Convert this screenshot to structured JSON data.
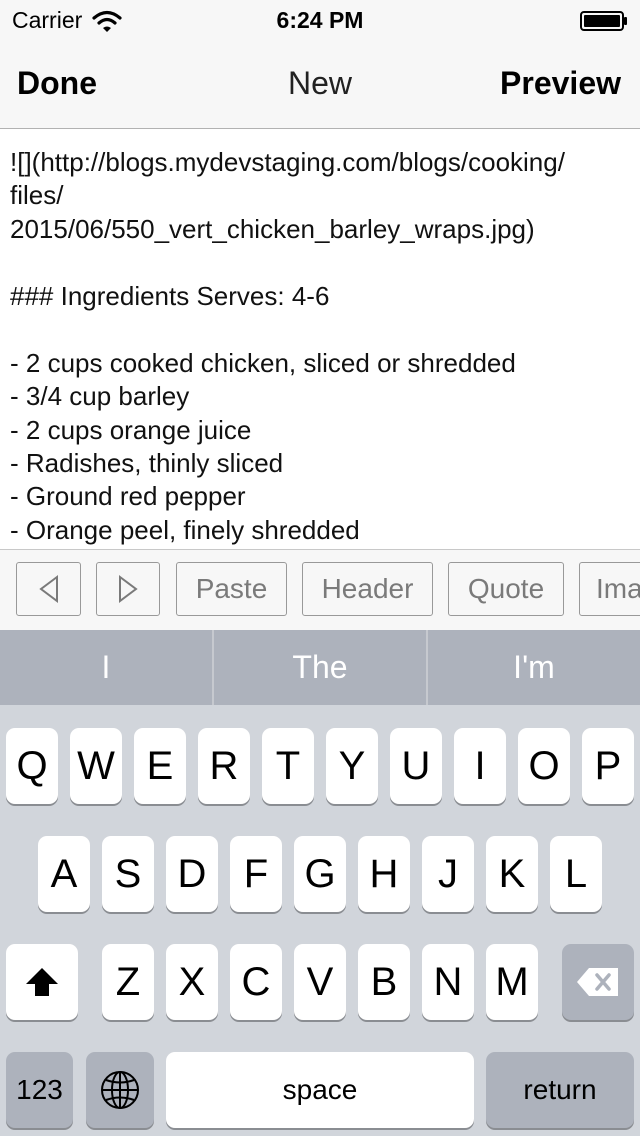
{
  "status_bar": {
    "carrier": "Carrier",
    "time": "6:24 PM"
  },
  "nav": {
    "left_label": "Done",
    "title": "New",
    "right_label": "Preview"
  },
  "editor": {
    "lines": [
      "![](http://blogs.mydevstaging.com/blogs/cooking/",
      "files/",
      "2015/06/550_vert_chicken_barley_wraps.jpg)",
      "",
      "### Ingredients Serves: 4-6",
      "",
      "- 2 cups cooked chicken, sliced or shredded",
      "- 3/4 cup barley",
      "- 2 cups orange juice",
      "- Radishes, thinly sliced",
      "- Ground red pepper",
      "- Orange peel, finely shredded"
    ]
  },
  "toolbar": {
    "prev_icon": "triangle-left-icon",
    "next_icon": "triangle-right-icon",
    "paste_label": "Paste",
    "header_label": "Header",
    "quote_label": "Quote",
    "image_label": "Ima"
  },
  "keyboard": {
    "predictions": [
      "I",
      "The",
      "I'm"
    ],
    "row1": [
      "Q",
      "W",
      "E",
      "R",
      "T",
      "Y",
      "U",
      "I",
      "O",
      "P"
    ],
    "row2": [
      "A",
      "S",
      "D",
      "F",
      "G",
      "H",
      "J",
      "K",
      "L"
    ],
    "row3": [
      "Z",
      "X",
      "C",
      "V",
      "B",
      "N",
      "M"
    ],
    "shift_icon": "shift-arrow-icon",
    "delete_icon": "backspace-icon",
    "numbers_label": "123",
    "globe_icon": "globe-icon",
    "space_label": "space",
    "return_label": "return"
  },
  "colors": {
    "keyboard_bg": "#d1d5db",
    "dark_key": "#adb2bc",
    "bar_bg": "#f7f7f7"
  }
}
